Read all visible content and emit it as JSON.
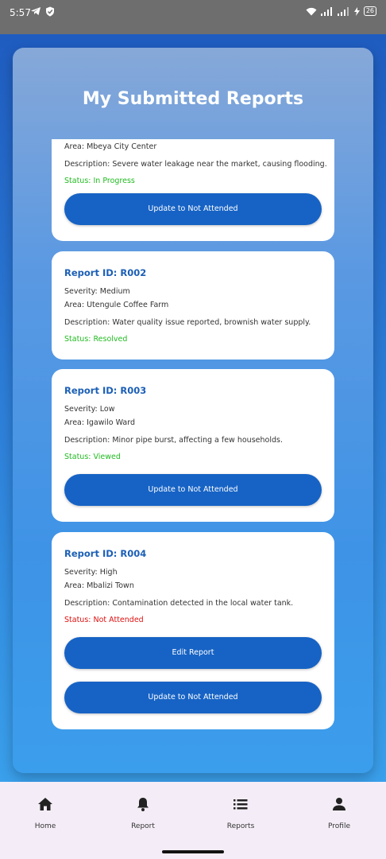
{
  "status_bar": {
    "time": "5:57",
    "battery": "26"
  },
  "page_title": "My Submitted Reports",
  "reports": [
    {
      "report_id": "",
      "severity": "",
      "area": "Area: Mbeya City Center",
      "description": "Description: Severe water leakage near the market, causing flooding.",
      "status": "Status: In Progress",
      "status_color": "#22bb22",
      "buttons": [
        "Update to Not Attended"
      ]
    },
    {
      "report_id": "Report ID: R002",
      "severity": "Severity: Medium",
      "area": "Area: Utengule Coffee Farm",
      "description": "Description: Water quality issue reported, brownish water supply.",
      "status": "Status: Resolved",
      "status_color": "#22bb22",
      "buttons": []
    },
    {
      "report_id": "Report ID: R003",
      "severity": "Severity: Low",
      "area": "Area: Igawilo Ward",
      "description": "Description: Minor pipe burst, affecting a few households.",
      "status": "Status: Viewed",
      "status_color": "#22bb22",
      "buttons": [
        "Update to Not Attended"
      ]
    },
    {
      "report_id": "Report ID: R004",
      "severity": "Severity: High",
      "area": "Area: Mbalizi Town",
      "description": "Description: Contamination detected in the local water tank.",
      "status": "Status: Not Attended",
      "status_color": "#dd1111",
      "buttons": [
        "Edit Report",
        "Update to Not Attended"
      ]
    }
  ],
  "bottom_nav": [
    {
      "label": "Home",
      "icon": "home-icon"
    },
    {
      "label": "Report",
      "icon": "bell-icon"
    },
    {
      "label": "Reports",
      "icon": "list-icon"
    },
    {
      "label": "Profile",
      "icon": "person-icon"
    }
  ],
  "colors": {
    "accent": "#1763c5",
    "title_blue": "#1b5fb6",
    "status_green": "#22bb22",
    "status_red": "#dd1111"
  }
}
